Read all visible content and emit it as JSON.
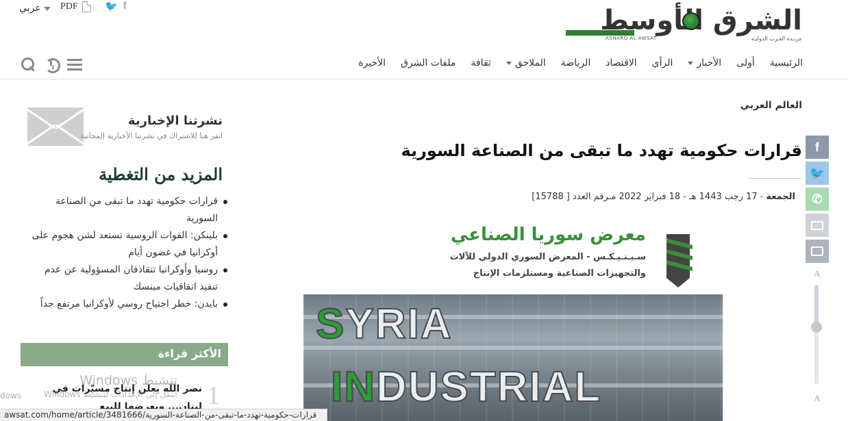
{
  "header": {
    "logo_text": "الشرق الأوسط",
    "logo_sub_en": "ASHARQ AL-AWSAT",
    "logo_sub_ar": "جريـدة العـرب الدوليـة",
    "language_label": "عربي",
    "pdf_label": "PDF",
    "social": [
      "twitter",
      "facebook"
    ]
  },
  "nav": {
    "items": [
      {
        "label": "الرئيسية",
        "dropdown": false
      },
      {
        "label": "أولى",
        "dropdown": false
      },
      {
        "label": "الأخبار",
        "dropdown": true
      },
      {
        "label": "الرأي",
        "dropdown": false
      },
      {
        "label": "الاقتصاد",
        "dropdown": false
      },
      {
        "label": "الرياضة",
        "dropdown": false
      },
      {
        "label": "الملاحق",
        "dropdown": true
      },
      {
        "label": "ثقافة",
        "dropdown": false
      },
      {
        "label": "ملفات الشرق",
        "dropdown": false
      },
      {
        "label": "الأخيرة",
        "dropdown": false
      }
    ],
    "tools": [
      "menu-icon",
      "history-icon",
      "search-icon"
    ]
  },
  "article": {
    "section": "العالم العربي",
    "title": "قرارات حكومية تهدد ما تبقى من الصناعة السورية",
    "date_day": "الجمعة",
    "date_hijri": "17 رجب 1443 هـ",
    "date_gregorian": "18 فبراير 2022 مـ",
    "issue": "رقم العدد [ 15788]",
    "image": {
      "expo_title": "معرض سوريا الصناعي",
      "expo_sub1": "سـيـنـيـكـس - المعرض السوري الدولي للآلات",
      "expo_sub2": "والتجهيزات الصناعية ومستلزمات الإنتاج",
      "word1_lead": "S",
      "word1_rest": "YRIA",
      "word2_lead": "IN",
      "word2_rest": "DUSTRIAL"
    }
  },
  "share": {
    "buttons": [
      "facebook",
      "twitter",
      "whatsapp",
      "email",
      "print"
    ],
    "font_increase": "A",
    "font_decrease": "A",
    "font_level": 0.43
  },
  "sidebar": {
    "newsletter_title": "نشرتنا الإخبارية",
    "newsletter_sub": "انقر هنا للاشتراك في نشرتنا الأخبارية المجانية",
    "more_title": "المزيد من التغطية",
    "more_items": [
      "قرارات حكومية تهدد ما تبقى من الصناعة السورية",
      "بلينكن: القوات الروسية تستعد لشن هجوم على أوكرانيا في غضون أيام",
      "روسيا وأوكرانيا تتقاذفان المسؤولية عن عدم تنفيذ اتفاقيات مينسك",
      "بايدن: خطر اجتياح روسي لأوكرانيا مرتفع جداً"
    ],
    "most_read_title": "الأكثر قراءة",
    "most_read_items": [
      {
        "number": "1",
        "text": "نصر الله يعلن إنتاج مسيّرات في لبنان... ويعرضها للبيع"
      }
    ]
  },
  "overlay": {
    "watermark_title": "تنشيط Windows",
    "watermark_sub": "انتقل إلى الإعدادات لتنشيط Windows",
    "watermark_left": "dows",
    "status_url": "awsat.com/home/article/3481666/قرارات-حكومية-تهدد-ما-تبقى-من-الصناعة-السورية"
  }
}
